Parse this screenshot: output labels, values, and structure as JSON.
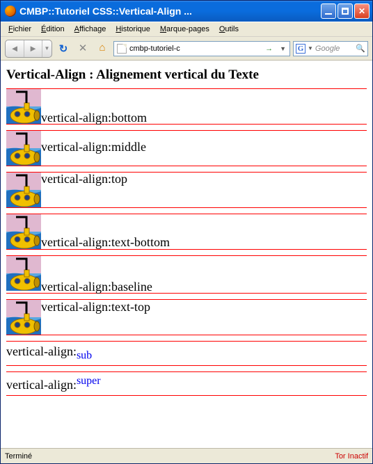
{
  "window": {
    "title": "CMBP::Tutoriel CSS::Vertical-Align ..."
  },
  "menu": {
    "items": [
      {
        "accel": "F",
        "rest": "ichier"
      },
      {
        "accel": "É",
        "rest": "dition"
      },
      {
        "accel": "A",
        "rest": "ffichage"
      },
      {
        "accel": "H",
        "rest": "istorique"
      },
      {
        "accel": "M",
        "rest": "arque-pages"
      },
      {
        "accel": "O",
        "rest": "utils"
      }
    ]
  },
  "toolbar": {
    "url": "cmbp-tutoriel-c",
    "search_placeholder": "Google"
  },
  "page": {
    "heading": "Vertical-Align : Alignement vertical du Texte",
    "rows": [
      {
        "label": "vertical-align:bottom"
      },
      {
        "label": "vertical-align:middle"
      },
      {
        "label": "vertical-align:top"
      },
      {
        "label": "vertical-align:text-bottom"
      },
      {
        "label": "vertical-align:baseline"
      },
      {
        "label": "vertical-align:text-top"
      }
    ],
    "sub_prefix": "vertical-align:",
    "sub_value": "sub",
    "super_prefix": "vertical-align:",
    "super_value": "super"
  },
  "status": {
    "left": "Terminé",
    "right": "Tor Inactif"
  }
}
